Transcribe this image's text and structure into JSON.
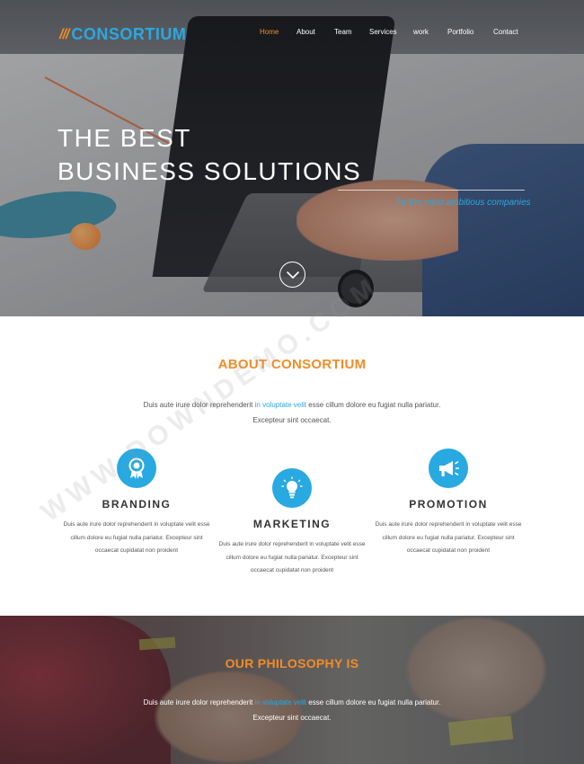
{
  "brand": {
    "mark": "///",
    "name": "CONSORTIUM"
  },
  "nav": [
    {
      "label": "Home",
      "active": true
    },
    {
      "label": "About"
    },
    {
      "label": "Team"
    },
    {
      "label": "Services"
    },
    {
      "label": "work"
    },
    {
      "label": "Portfolio"
    },
    {
      "label": "Contact"
    }
  ],
  "hero": {
    "title_line1": "THE BEST",
    "title_line2": "BUSINESS SOLUTIONS",
    "tagline": "for the most ambitious companies",
    "scroll_icon": "chevron-down-icon"
  },
  "about": {
    "title": "ABOUT CONSORTIUM",
    "text_before": "Duis aute irure dolor reprehenderit ",
    "text_highlight": "in voluptate velit",
    "text_after": " esse cillum dolore eu fugiat nulla pariatur.",
    "text_line2": "Excepteur sint occaecat."
  },
  "features": [
    {
      "icon": "award-ribbon-icon",
      "title": "BRANDING",
      "text": "Duis aute irure dolor reprehenderit in voluptate velit esse cillum dolore eu fugiat nulla pariatur. Excepteur sint occaecat cupidatat non proident"
    },
    {
      "icon": "lightbulb-icon",
      "title": "MARKETING",
      "text": "Duis aute irure dolor reprehenderit in voluptate velit esse cillum dolore eu fugiat nulla pariatur. Excepteur sint occaecat cupidatat non proident"
    },
    {
      "icon": "megaphone-icon",
      "title": "PROMOTION",
      "text": "Duis aute irure dolor reprehenderit in voluptate velit esse cillum dolore eu fugiat nulla pariatur. Excepteur sint occaecat cupidatat non proident"
    }
  ],
  "philosophy": {
    "title": "OUR PHILOSOPHY IS",
    "text_before": "Duis aute irure dolor reprehenderit ",
    "text_highlight": "in voluptate velit",
    "text_after": " esse cillum dolore eu fugiat nulla pariatur.",
    "text_line2": "Excepteur sint occaecat."
  },
  "watermark": "WWW.DOWNDEMO.COM",
  "colors": {
    "accent_orange": "#f28c28",
    "accent_blue": "#29a9e1",
    "heading_dark": "#333333",
    "body_text": "#555555"
  }
}
